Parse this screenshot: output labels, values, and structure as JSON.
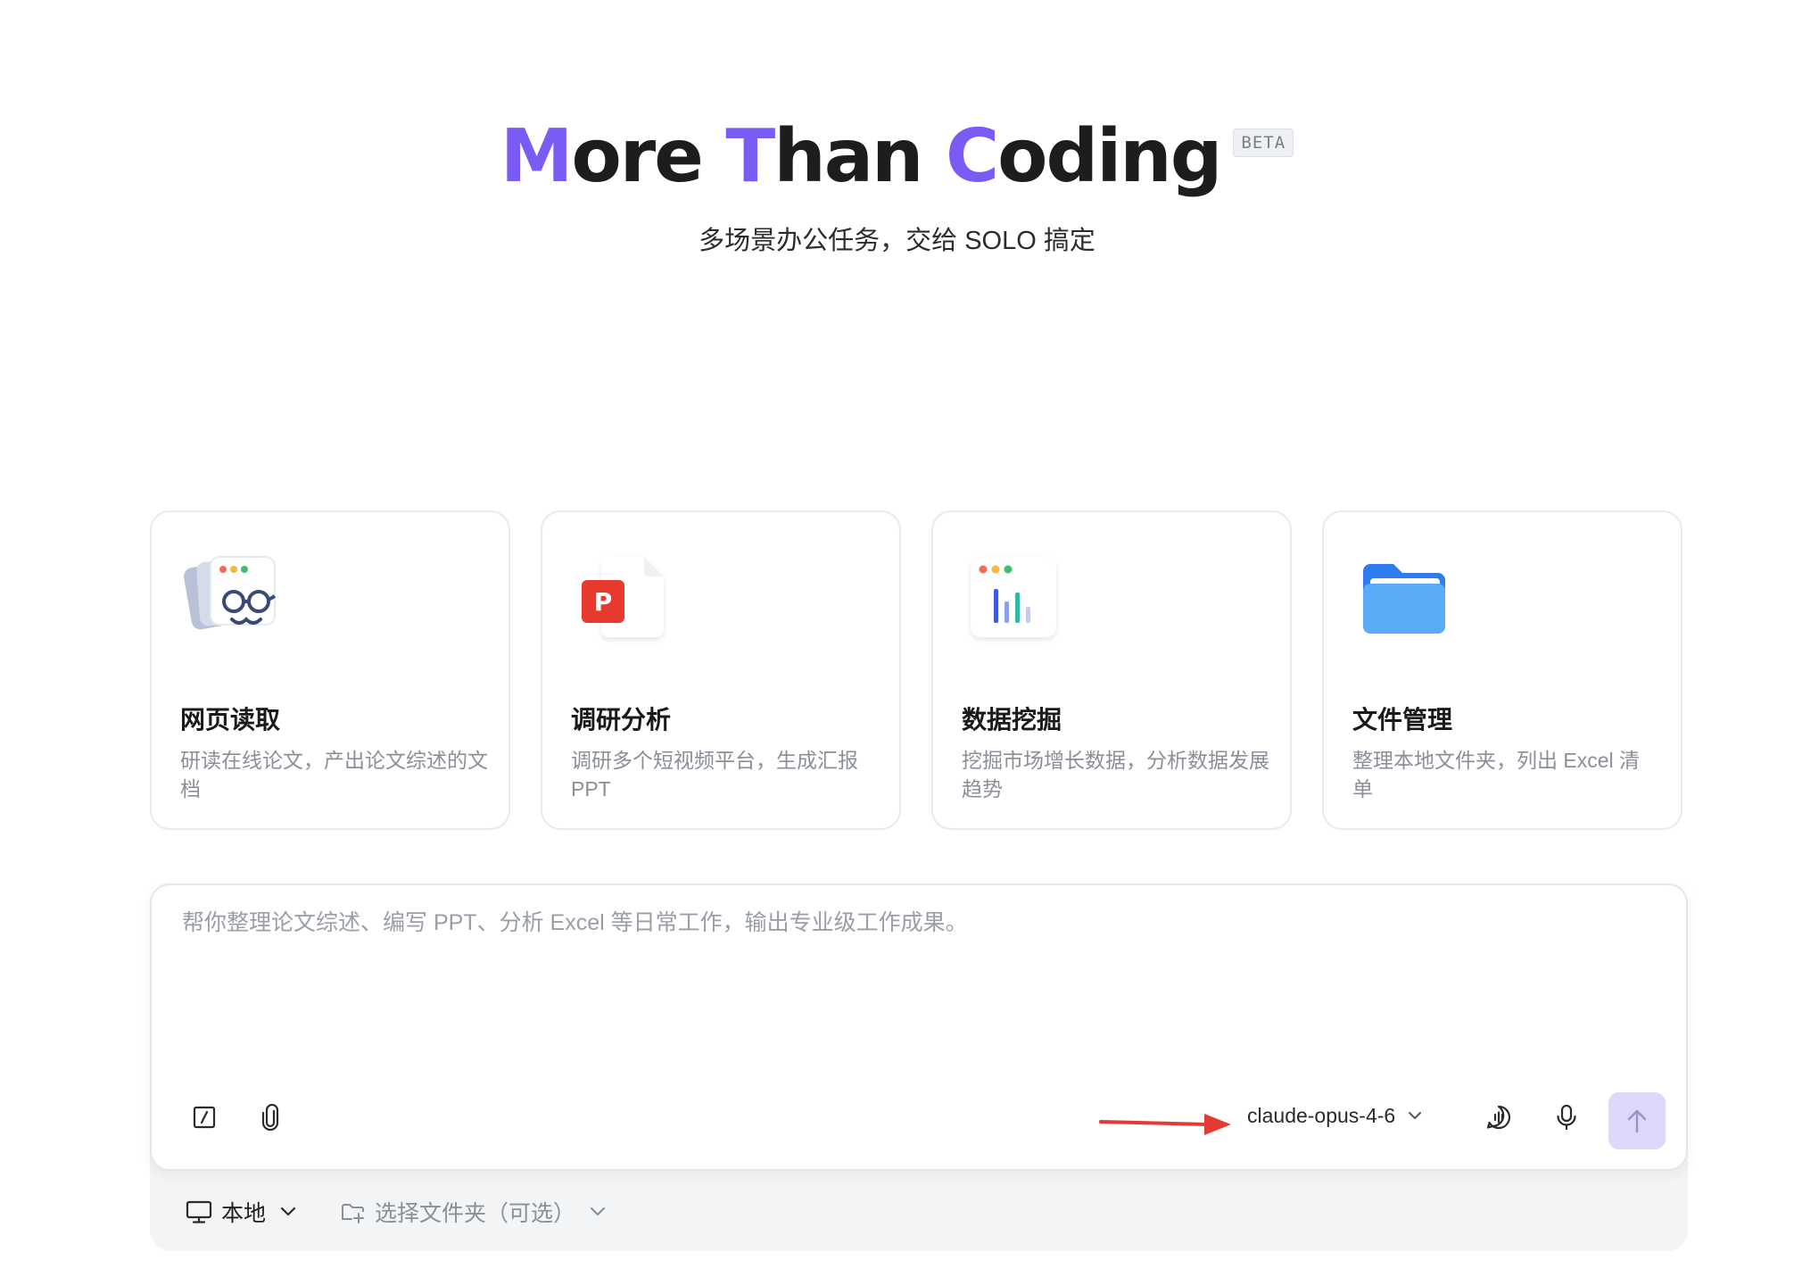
{
  "hero": {
    "title_words": [
      {
        "cap": "M",
        "rest": "ore"
      },
      {
        "cap": "T",
        "rest": "han"
      },
      {
        "cap": "C",
        "rest": "oding"
      }
    ],
    "badge": "BETA",
    "subtitle": "多场景办公任务，交给 SOLO 搞定"
  },
  "cards": [
    {
      "icon": "web-reader-icon",
      "title": "网页读取",
      "desc": "研读在线论文，产出论文综述的文档"
    },
    {
      "icon": "ppt-file-icon",
      "title": "调研分析",
      "desc": "调研多个短视频平台，生成汇报 PPT"
    },
    {
      "icon": "bar-chart-icon",
      "title": "数据挖掘",
      "desc": "挖掘市场增长数据，分析数据发展趋势"
    },
    {
      "icon": "folder-icon",
      "title": "文件管理",
      "desc": "整理本地文件夹，列出 Excel 清单"
    }
  ],
  "composer": {
    "placeholder": "帮你整理论文综述、编写 PPT、分析 Excel 等日常工作，输出专业级工作成果。",
    "value": "",
    "model": "claude-opus-4-6"
  },
  "bottom_bar": {
    "environment": "本地",
    "folder": "选择文件夹（可选）"
  },
  "colors": {
    "accent": "#7a5cf5",
    "send_button_bg": "#ddd8fb",
    "annotation_arrow": "#e53935"
  }
}
